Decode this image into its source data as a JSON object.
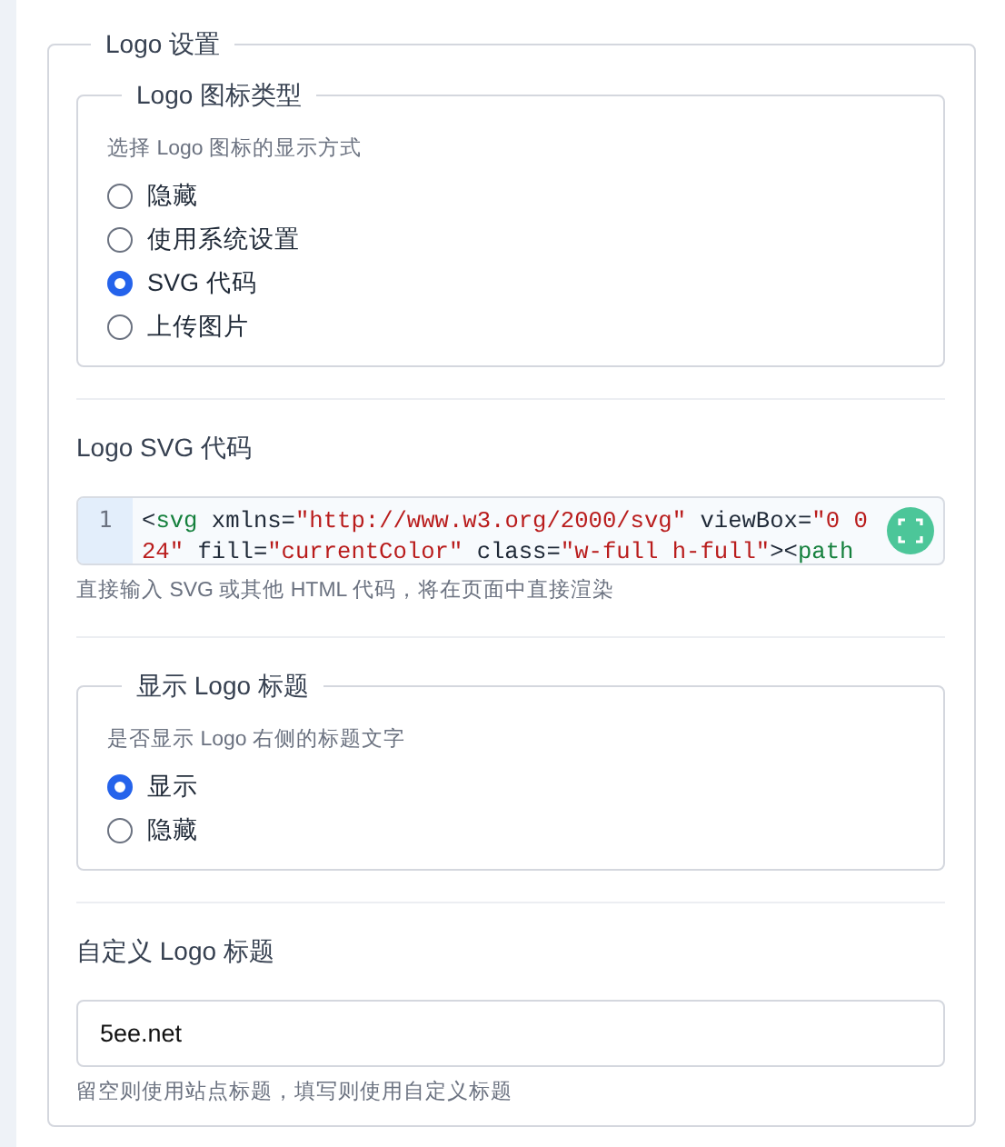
{
  "panel": {
    "title": "Logo 设置",
    "icon_type": {
      "legend": "Logo 图标类型",
      "hint": "选择 Logo 图标的显示方式",
      "options": [
        {
          "label": "隐藏",
          "selected": false
        },
        {
          "label": "使用系统设置",
          "selected": false
        },
        {
          "label": "SVG 代码",
          "selected": true
        },
        {
          "label": "上传图片",
          "selected": false
        }
      ]
    },
    "svg_code": {
      "label": "Logo SVG 代码",
      "line_number": "1",
      "rows": [
        "<svg xmlns=\"http://www.w3.org/2000/svg\" viewBox=\"0 0",
        "24\" fill=\"currentColor\" class=\"w-full h-full\"><path"
      ],
      "help": "直接输入 SVG 或其他 HTML 代码，将在页面中直接渲染"
    },
    "show_title": {
      "legend": "显示 Logo 标题",
      "hint": "是否显示 Logo 右侧的标题文字",
      "options": [
        {
          "label": "显示",
          "selected": true
        },
        {
          "label": "隐藏",
          "selected": false
        }
      ]
    },
    "custom_title": {
      "label": "自定义 Logo 标题",
      "value": "5ee.net",
      "help": "留空则使用站点标题，填写则使用自定义标题"
    }
  }
}
